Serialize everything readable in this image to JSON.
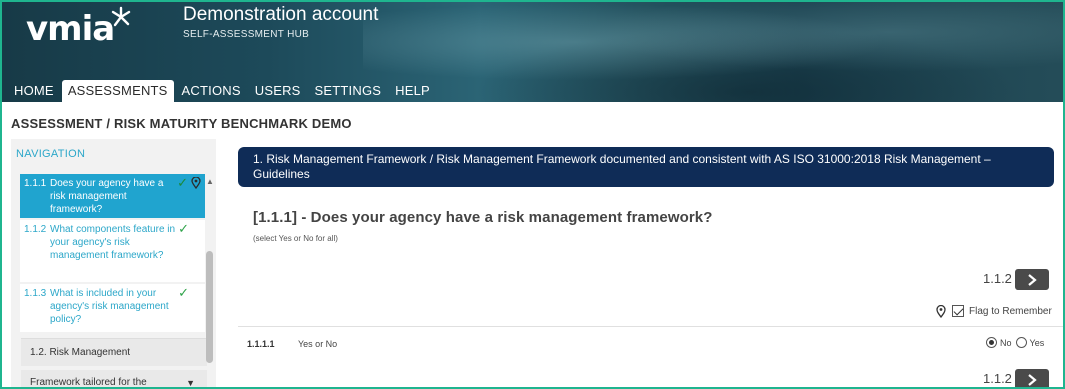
{
  "header": {
    "logo_text": "vmia",
    "account_title": "Demonstration account",
    "account_subtitle": "SELF-ASSESSMENT HUB"
  },
  "topnav": {
    "items": [
      {
        "label": "HOME",
        "active": false
      },
      {
        "label": "ASSESSMENTS",
        "active": true
      },
      {
        "label": "ACTIONS",
        "active": false
      },
      {
        "label": "USERS",
        "active": false
      },
      {
        "label": "SETTINGS",
        "active": false
      },
      {
        "label": "HELP",
        "active": false
      }
    ]
  },
  "breadcrumb": "ASSESSMENT / RISK MATURITY BENCHMARK DEMO",
  "sidebar": {
    "heading": "NAVIGATION",
    "items": [
      {
        "num": "1.1.1",
        "text": "Does your agency have a risk management framework?",
        "completed": true,
        "flagged": true,
        "active": true
      },
      {
        "num": "1.1.2",
        "text": "What components feature in your agency's risk management framework?",
        "completed": true,
        "flagged": false,
        "active": false
      },
      {
        "num": "1.1.3",
        "text": "What is included in your agency's risk management policy?",
        "completed": true,
        "flagged": false,
        "active": false
      }
    ],
    "sections": [
      {
        "label": "1.2. Risk Management"
      },
      {
        "label": "Framework tailored for the"
      }
    ]
  },
  "main": {
    "banner": "1. Risk Management Framework / Risk Management Framework documented and consistent with AS ISO 31000:2018 Risk Management – Guidelines",
    "question_title": "[1.1.1] - Does your agency have a risk management framework?",
    "question_hint": "(select Yes or No for all)",
    "next_label_top": "1.1.2",
    "flag_label": "Flag to Remember",
    "flag_checked": true,
    "sub_question": {
      "num": "1.1.1.1",
      "label": "Yes or No",
      "options": [
        {
          "label": "No",
          "selected": true
        },
        {
          "label": "Yes",
          "selected": false
        }
      ]
    },
    "next_label_bottom": "1.1.2"
  },
  "colors": {
    "frame_border": "#1fb58f",
    "active_nav_item": "#20a4cf",
    "banner_bg": "#0f2c57",
    "link_blue": "#2ca7c9",
    "check_green": "#2fa34a"
  }
}
